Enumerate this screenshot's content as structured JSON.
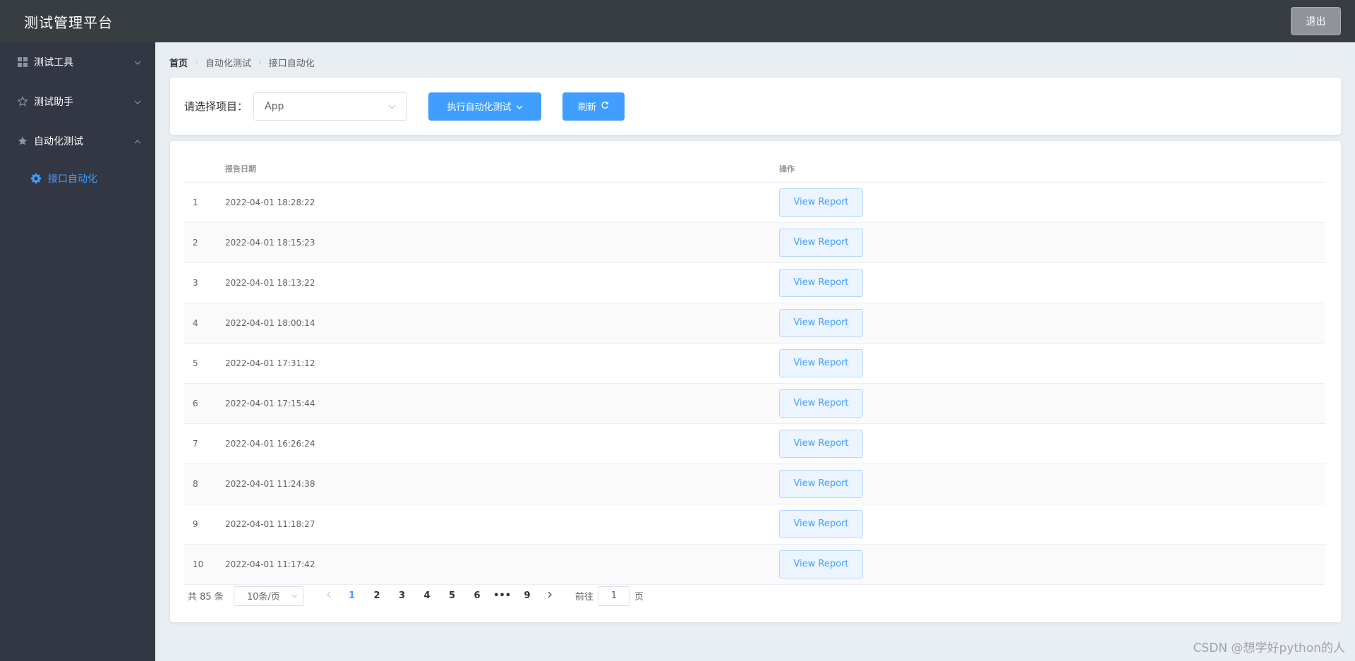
{
  "app": {
    "title": "测试管理平台",
    "logout_label": "退出"
  },
  "sidebar": {
    "menus": [
      {
        "label": "测试工具",
        "icon": "grid-icon",
        "arrow": "chevron-down"
      },
      {
        "label": "测试助手",
        "icon": "star-outline-icon",
        "arrow": "chevron-down"
      },
      {
        "label": "自动化测试",
        "icon": "star-filled-icon",
        "arrow": "chevron-up"
      }
    ],
    "active_submenu": {
      "label": "接口自动化",
      "icon": "gear-icon"
    }
  },
  "breadcrumb": [
    "首页",
    "自动化测试",
    "接口自动化"
  ],
  "toolbar": {
    "project_label": "请选择项目：",
    "project_value": "App",
    "exec_label": "执行自动化测试",
    "refresh_label": "刷新"
  },
  "table": {
    "headers": {
      "index": "",
      "date": "报告日期",
      "action": "操作"
    },
    "rows": [
      {
        "index": "1",
        "date": "2022-04-01 18:28:22",
        "action": "View Report"
      },
      {
        "index": "2",
        "date": "2022-04-01 18:15:23",
        "action": "View Report"
      },
      {
        "index": "3",
        "date": "2022-04-01 18:13:22",
        "action": "View Report"
      },
      {
        "index": "4",
        "date": "2022-04-01 18:00:14",
        "action": "View Report"
      },
      {
        "index": "5",
        "date": "2022-04-01 17:31:12",
        "action": "View Report"
      },
      {
        "index": "6",
        "date": "2022-04-01 17:15:44",
        "action": "View Report"
      },
      {
        "index": "7",
        "date": "2022-04-01 16:26:24",
        "action": "View Report"
      },
      {
        "index": "8",
        "date": "2022-04-01 11:24:38",
        "action": "View Report"
      },
      {
        "index": "9",
        "date": "2022-04-01 11:18:27",
        "action": "View Report"
      },
      {
        "index": "10",
        "date": "2022-04-01 11:17:42",
        "action": "View Report"
      }
    ]
  },
  "pagination": {
    "total_text": "共 85 条",
    "page_size": "10条/页",
    "pages": [
      "1",
      "2",
      "3",
      "4",
      "5",
      "6",
      "•••",
      "9"
    ],
    "current_page": "1",
    "goto_prefix": "前往",
    "goto_value": "1",
    "goto_suffix": "页"
  },
  "watermark": "CSDN @想学好python的人",
  "colors": {
    "primary": "#409eff",
    "header_bg": "#373d41",
    "sidebar_bg": "#333744",
    "main_bg": "#e9eef3"
  }
}
